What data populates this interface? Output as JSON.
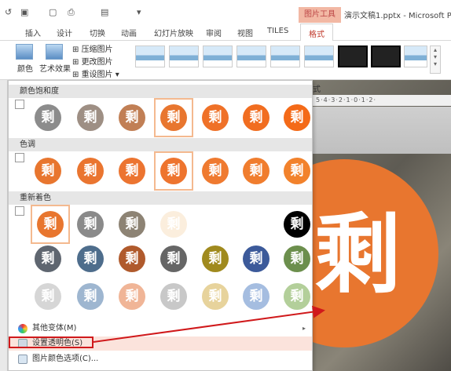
{
  "titlebar": {
    "context_tab": "图片工具",
    "window_title": "演示文稿1.pptx - Microsoft Pov"
  },
  "tabs": [
    "插入",
    "设计",
    "切换",
    "动画",
    "幻灯片放映",
    "审阅",
    "视图",
    "TILES",
    "格式"
  ],
  "ribbon": {
    "color_btn": "颜色",
    "art_btn": "艺术效果",
    "compress": "压缩图片",
    "change": "更改图片",
    "reset": "重设图片",
    "shift_label": "式"
  },
  "ruler": "5·4·3·2·1·0·1·2·",
  "panel": {
    "saturation_title": "颜色饱和度",
    "tone_title": "色调",
    "recolor_title": "重新着色",
    "glyph": "剩",
    "more_variants": "其他变体(M)",
    "set_transparent": "设置透明色(S)",
    "color_options": "图片颜色选项(C)..."
  },
  "colors": {
    "accent": "#e8762f",
    "highlight": "#d0191b"
  }
}
